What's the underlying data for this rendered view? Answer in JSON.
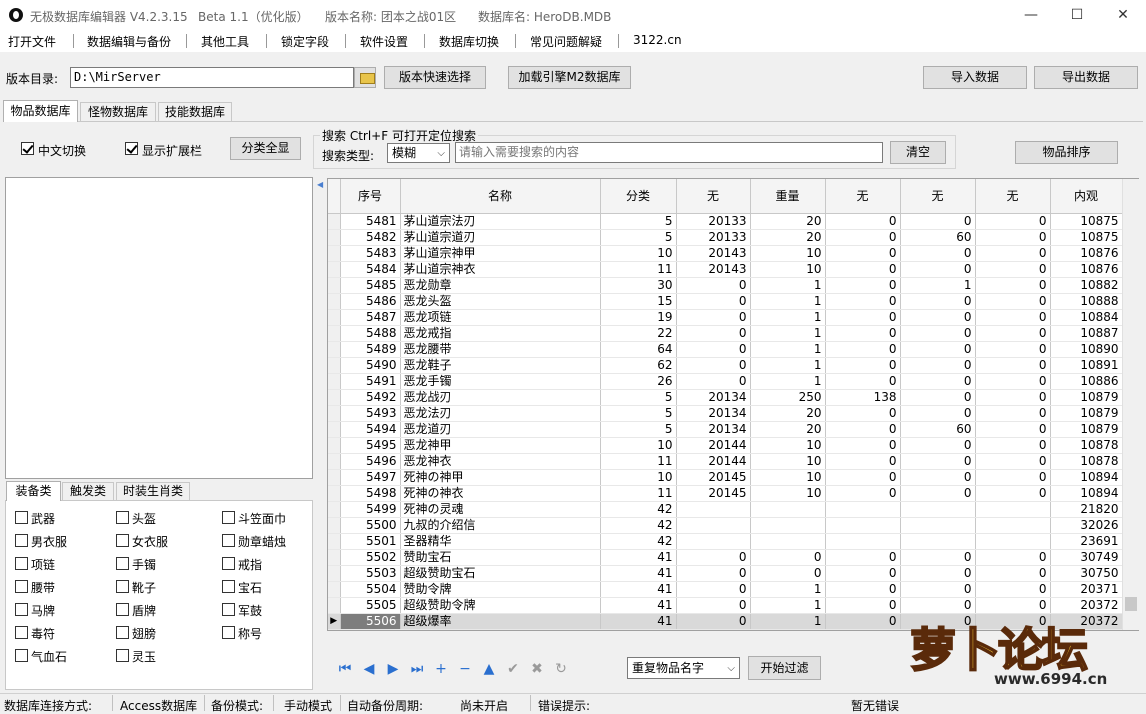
{
  "window": {
    "title_app": "无极数据库编辑器 V4.2.3.15",
    "title_beta": "Beta 1.1（优化版）",
    "title_version": "版本名称: 团本之战01区",
    "title_db": "数据库名: HeroDB.MDB",
    "minimize": "—",
    "maximize": "☐",
    "close": "✕"
  },
  "menu": [
    "打开文件",
    "数据编辑与备份",
    "其他工具",
    "锁定字段",
    "软件设置",
    "数据库切换",
    "常见问题解疑",
    "3122.cn"
  ],
  "toolbar": {
    "dir_label": "版本目录:",
    "dir_value": "D:\\MirServer",
    "quick_select": "版本快速选择",
    "load_engine": "加载引擎M2数据库",
    "import": "导入数据",
    "export": "导出数据"
  },
  "main_tabs": [
    "物品数据库",
    "怪物数据库",
    "技能数据库"
  ],
  "options": {
    "chinese_switch": "中文切换",
    "show_ext": "显示扩展栏",
    "show_all": "分类全显",
    "search_title": "搜索  Ctrl+F 可打开定位搜索",
    "search_type_label": "搜索类型:",
    "search_type_value": "模糊",
    "search_placeholder": "请输入需要搜索的内容",
    "clear": "清空",
    "sort": "物品排序"
  },
  "category_tabs": [
    "装备类",
    "触发类",
    "时装生肖类"
  ],
  "categories": [
    "武器",
    "头盔",
    "斗笠面巾",
    "男衣服",
    "女衣服",
    "勋章蜡烛",
    "项链",
    "手镯",
    "戒指",
    "腰带",
    "靴子",
    "宝石",
    "马牌",
    "盾牌",
    "军鼓",
    "毒符",
    "翅膀",
    "称号",
    "气血石",
    "灵玉"
  ],
  "grid": {
    "headers": [
      "序号",
      "名称",
      "分类",
      "无",
      "重量",
      "无",
      "无",
      "无",
      "内观"
    ],
    "rows": [
      [
        "5481",
        "茅山道宗法刃",
        "5",
        "20133",
        "20",
        "0",
        "0",
        "0",
        "10875"
      ],
      [
        "5482",
        "茅山道宗道刃",
        "5",
        "20133",
        "20",
        "0",
        "60",
        "0",
        "10875"
      ],
      [
        "5483",
        "茅山道宗神甲",
        "10",
        "20143",
        "10",
        "0",
        "0",
        "0",
        "10876"
      ],
      [
        "5484",
        "茅山道宗神衣",
        "11",
        "20143",
        "10",
        "0",
        "0",
        "0",
        "10876"
      ],
      [
        "5485",
        "恶龙勋章",
        "30",
        "0",
        "1",
        "0",
        "1",
        "0",
        "10882"
      ],
      [
        "5486",
        "恶龙头盔",
        "15",
        "0",
        "1",
        "0",
        "0",
        "0",
        "10888"
      ],
      [
        "5487",
        "恶龙项链",
        "19",
        "0",
        "1",
        "0",
        "0",
        "0",
        "10884"
      ],
      [
        "5488",
        "恶龙戒指",
        "22",
        "0",
        "1",
        "0",
        "0",
        "0",
        "10887"
      ],
      [
        "5489",
        "恶龙腰带",
        "64",
        "0",
        "1",
        "0",
        "0",
        "0",
        "10890"
      ],
      [
        "5490",
        "恶龙鞋子",
        "62",
        "0",
        "1",
        "0",
        "0",
        "0",
        "10891"
      ],
      [
        "5491",
        "恶龙手镯",
        "26",
        "0",
        "1",
        "0",
        "0",
        "0",
        "10886"
      ],
      [
        "5492",
        "恶龙战刃",
        "5",
        "20134",
        "250",
        "138",
        "0",
        "0",
        "10879"
      ],
      [
        "5493",
        "恶龙法刃",
        "5",
        "20134",
        "20",
        "0",
        "0",
        "0",
        "10879"
      ],
      [
        "5494",
        "恶龙道刃",
        "5",
        "20134",
        "20",
        "0",
        "60",
        "0",
        "10879"
      ],
      [
        "5495",
        "恶龙神甲",
        "10",
        "20144",
        "10",
        "0",
        "0",
        "0",
        "10878"
      ],
      [
        "5496",
        "恶龙神衣",
        "11",
        "20144",
        "10",
        "0",
        "0",
        "0",
        "10878"
      ],
      [
        "5497",
        "死神の神甲",
        "10",
        "20145",
        "10",
        "0",
        "0",
        "0",
        "10894"
      ],
      [
        "5498",
        "死神の神衣",
        "11",
        "20145",
        "10",
        "0",
        "0",
        "0",
        "10894"
      ],
      [
        "5499",
        "死神の灵魂",
        "42",
        "",
        "",
        "",
        "",
        "",
        "21820"
      ],
      [
        "5500",
        "九叔的介绍信",
        "42",
        "",
        "",
        "",
        "",
        "",
        "32026"
      ],
      [
        "5501",
        "圣器精华",
        "42",
        "",
        "",
        "",
        "",
        "",
        "23691"
      ],
      [
        "5502",
        "赞助宝石",
        "41",
        "0",
        "0",
        "0",
        "0",
        "0",
        "30749"
      ],
      [
        "5503",
        "超级赞助宝石",
        "41",
        "0",
        "0",
        "0",
        "0",
        "0",
        "30750"
      ],
      [
        "5504",
        "赞助令牌",
        "41",
        "0",
        "1",
        "0",
        "0",
        "0",
        "20371"
      ],
      [
        "5505",
        "超级赞助令牌",
        "41",
        "0",
        "1",
        "0",
        "0",
        "0",
        "20372"
      ],
      [
        "5506",
        "超级爆率",
        "41",
        "0",
        "1",
        "0",
        "0",
        "0",
        "20372"
      ]
    ]
  },
  "bottom": {
    "dup_select": "重复物品名字",
    "start_filter": "开始过滤",
    "nav_icons": [
      "⏮",
      "◀",
      "▶",
      "⏭",
      "+",
      "−",
      "▲",
      "✔",
      "✖",
      "↻"
    ]
  },
  "status": {
    "conn_label": "数据库连接方式:",
    "conn_value": "Access数据库",
    "backup_label": "备份模式:",
    "backup_value": "手动模式",
    "auto_label": "自动备份周期:",
    "auto_value": "尚未开启",
    "err_label": "错误提示:",
    "err_value": "暂无错误"
  },
  "watermark": {
    "text": "萝卜论坛",
    "url": "www.6994.cn"
  }
}
